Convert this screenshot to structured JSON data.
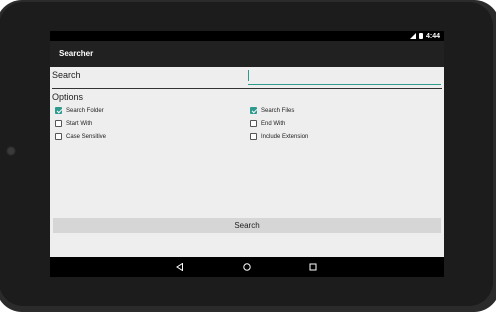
{
  "status_bar": {
    "time": "4:44",
    "icons": [
      "signal-icon",
      "battery-icon"
    ]
  },
  "app": {
    "title": "Searcher"
  },
  "search": {
    "label": "Search",
    "value": "",
    "placeholder": ""
  },
  "options": {
    "label": "Options",
    "items": [
      {
        "label": "Search Folder",
        "checked": true
      },
      {
        "label": "Search Files",
        "checked": true
      },
      {
        "label": "Start With",
        "checked": false
      },
      {
        "label": "End With",
        "checked": false
      },
      {
        "label": "Case Sensitive",
        "checked": false
      },
      {
        "label": "Include Extension",
        "checked": false
      }
    ]
  },
  "actions": {
    "search_button": "Search"
  },
  "nav_bar": {
    "icons": [
      "back-icon",
      "home-icon",
      "recents-icon"
    ]
  },
  "colors": {
    "accent": "#2e9b8e",
    "action_bar": "#212121",
    "content_bg": "#eeeeee",
    "button_bg": "#d6d6d6"
  }
}
